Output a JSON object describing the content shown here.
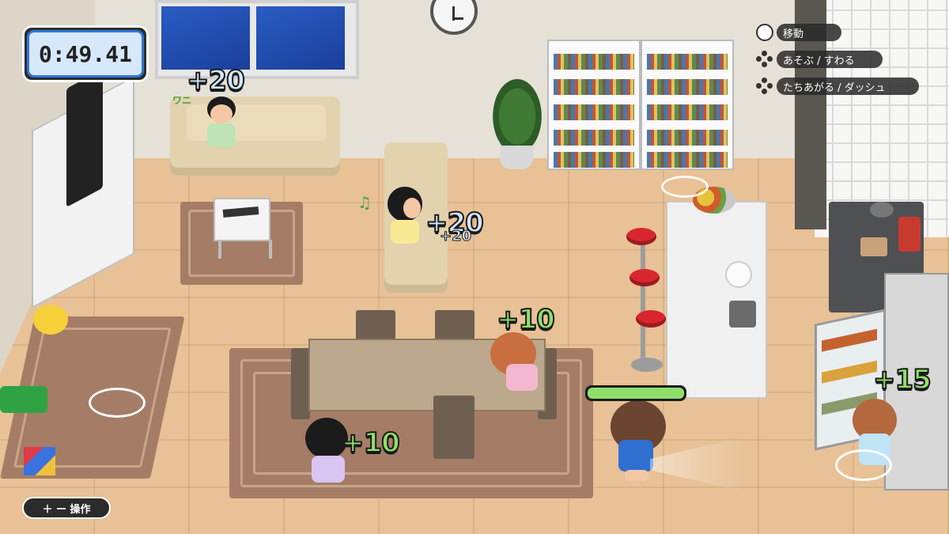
{
  "hud": {
    "timer": "0:49.41",
    "controls": [
      {
        "icon": "circle-button-icon",
        "label": "移動"
      },
      {
        "icon": "dpad-icon",
        "label": "あそぶ / すわる"
      },
      {
        "icon": "dpad-icon",
        "label": "たちあがる / ダッシュ"
      }
    ],
    "ops_label": "＋ ー 操作"
  },
  "scores": {
    "sofa_kid": "+20",
    "armchair_kid": "+20",
    "armchair_kid_small": "+20",
    "table_kid_pink": "+10",
    "table_kid_front": "+10",
    "fridge_kid": "+15"
  },
  "effects": {
    "sofa_kid_text": "ワニ"
  },
  "player": {
    "energy_level": 1.0
  },
  "colors": {
    "timer_border": "#2e76d8",
    "score_blue": "#cfe6ff",
    "score_green": "#8fe06b",
    "stool_red": "#d8262f"
  }
}
